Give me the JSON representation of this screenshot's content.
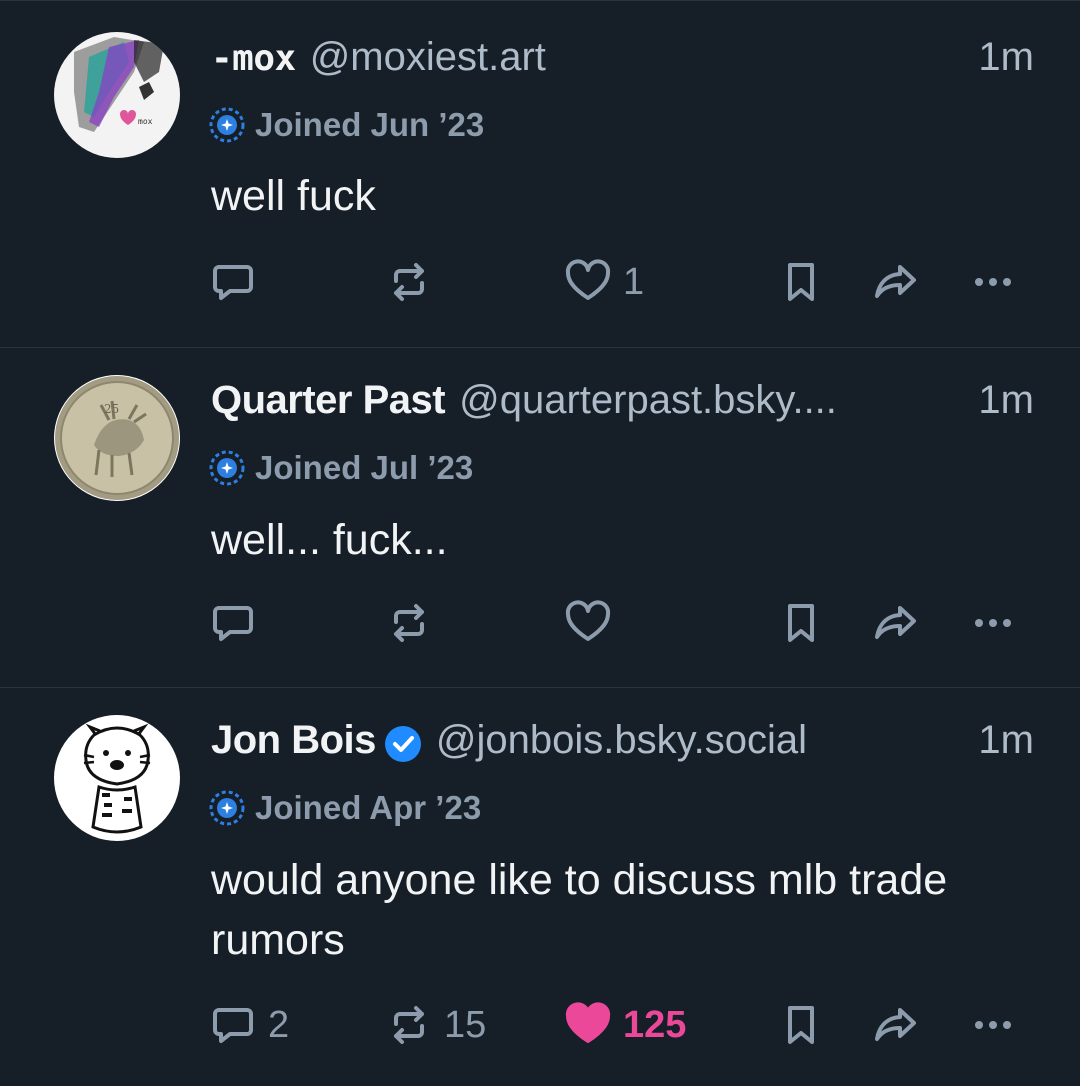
{
  "posts": [
    {
      "display_name": "-mox",
      "handle": "@moxiest.art",
      "time": "1m",
      "joined": "Joined Jun ’23",
      "text": "well fuck",
      "reply_count": "",
      "repost_count": "",
      "like_count": "1",
      "liked": false,
      "verified": false
    },
    {
      "display_name": "Quarter Past",
      "handle": "@quarterpast.bsky....",
      "time": "1m",
      "joined": "Joined Jul ’23",
      "text": "well... fuck...",
      "reply_count": "",
      "repost_count": "",
      "like_count": "",
      "liked": false,
      "verified": false
    },
    {
      "display_name": "Jon Bois",
      "handle": "@jonbois.bsky.social",
      "time": "1m",
      "joined": "Joined Apr ’23",
      "text": "would anyone like to discuss mlb trade rumors",
      "reply_count": "2",
      "repost_count": "15",
      "like_count": "125",
      "liked": true,
      "verified": true
    }
  ],
  "avatar_texts": {
    "mox": "mox",
    "coin": "25"
  },
  "colors": {
    "background": "#161e27",
    "divider": "#2a3441",
    "handle": "#aebbc9",
    "icon": "#8d9cac",
    "like_active": "#ec4899",
    "verified": "#208bfe",
    "joined_badge": "#2d7fe0"
  },
  "icons": {
    "reply": "speech-bubble-icon",
    "repost": "repost-arrows-icon",
    "like": "heart-icon",
    "bookmark": "bookmark-icon",
    "share": "share-arrow-icon",
    "more": "more-dots-icon",
    "joined": "new-user-badge-icon",
    "verified": "verified-check-icon"
  }
}
